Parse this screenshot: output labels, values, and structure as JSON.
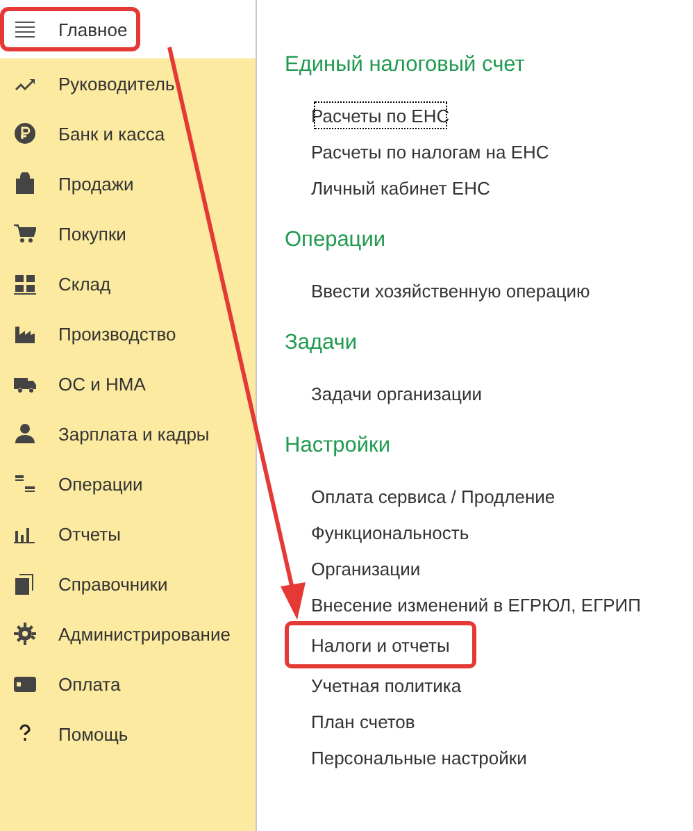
{
  "sidebar": {
    "items": [
      {
        "label": "Главное",
        "selected": true,
        "highlighted": true
      },
      {
        "label": "Руководитель",
        "selected": false,
        "highlighted": false
      },
      {
        "label": "Банк и касса",
        "selected": false,
        "highlighted": false
      },
      {
        "label": "Продажи",
        "selected": false,
        "highlighted": false
      },
      {
        "label": "Покупки",
        "selected": false,
        "highlighted": false
      },
      {
        "label": "Склад",
        "selected": false,
        "highlighted": false
      },
      {
        "label": "Производство",
        "selected": false,
        "highlighted": false
      },
      {
        "label": "ОС и НМА",
        "selected": false,
        "highlighted": false
      },
      {
        "label": "Зарплата и кадры",
        "selected": false,
        "highlighted": false
      },
      {
        "label": "Операции",
        "selected": false,
        "highlighted": false
      },
      {
        "label": "Отчеты",
        "selected": false,
        "highlighted": false
      },
      {
        "label": "Справочники",
        "selected": false,
        "highlighted": false
      },
      {
        "label": "Администрирование",
        "selected": false,
        "highlighted": false
      },
      {
        "label": "Оплата",
        "selected": false,
        "highlighted": false
      },
      {
        "label": "Помощь",
        "selected": false,
        "highlighted": false
      }
    ]
  },
  "sections": [
    {
      "title": "Единый налоговый счет",
      "links": [
        {
          "label": "Расчеты по ЕНС",
          "focused": true,
          "highlighted": false
        },
        {
          "label": "Расчеты по налогам на ЕНС",
          "focused": false,
          "highlighted": false
        },
        {
          "label": "Личный кабинет ЕНС",
          "focused": false,
          "highlighted": false
        }
      ]
    },
    {
      "title": "Операции",
      "links": [
        {
          "label": "Ввести хозяйственную операцию",
          "focused": false,
          "highlighted": false
        }
      ]
    },
    {
      "title": "Задачи",
      "links": [
        {
          "label": "Задачи организации",
          "focused": false,
          "highlighted": false
        }
      ]
    },
    {
      "title": "Настройки",
      "links": [
        {
          "label": "Оплата сервиса / Продление",
          "focused": false,
          "highlighted": false
        },
        {
          "label": "Функциональность",
          "focused": false,
          "highlighted": false
        },
        {
          "label": "Организации",
          "focused": false,
          "highlighted": false
        },
        {
          "label": "Внесение изменений в ЕГРЮЛ, ЕГРИП",
          "focused": false,
          "highlighted": false
        },
        {
          "label": "Налоги и отчеты",
          "focused": false,
          "highlighted": true
        },
        {
          "label": "Учетная политика",
          "focused": false,
          "highlighted": false
        },
        {
          "label": "План счетов",
          "focused": false,
          "highlighted": false
        },
        {
          "label": "Персональные настройки",
          "focused": false,
          "highlighted": false
        }
      ]
    }
  ]
}
